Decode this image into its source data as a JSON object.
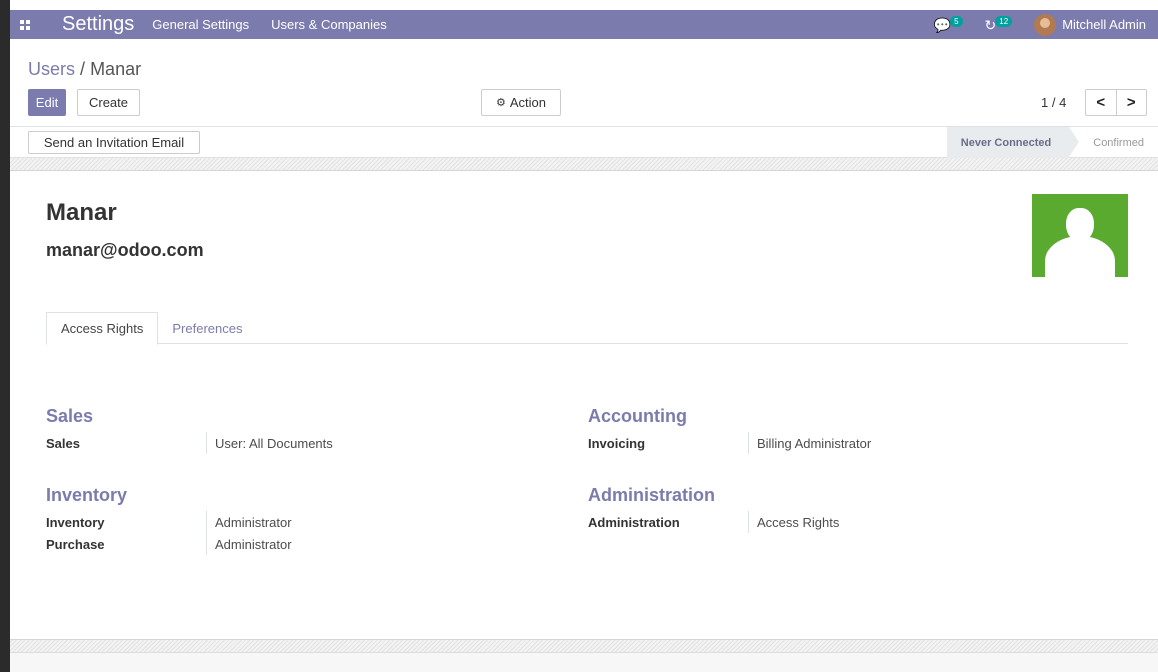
{
  "navbar": {
    "app_title": "Settings",
    "menu": [
      {
        "label": "General Settings"
      },
      {
        "label": "Users & Companies"
      }
    ],
    "messages_count": "5",
    "activities_count": "12",
    "user_name": "Mitchell Admin",
    "accent_color": "#7c7bad"
  },
  "breadcrumb": {
    "parent": "Users",
    "separator": "/",
    "current": "Manar"
  },
  "buttons": {
    "edit": "Edit",
    "create": "Create",
    "action": "Action",
    "invite": "Send an Invitation Email"
  },
  "pager": {
    "value": "1 / 4",
    "prev": "<",
    "next": ">"
  },
  "status": {
    "stages": [
      {
        "label": "Never Connected",
        "active": true
      },
      {
        "label": "Confirmed",
        "active": false
      }
    ]
  },
  "record": {
    "name": "Manar",
    "email": "manar@odoo.com",
    "photo_color": "#5aaa2f"
  },
  "tabs": [
    {
      "label": "Access Rights",
      "active": true
    },
    {
      "label": "Preferences",
      "active": false
    }
  ],
  "groups": {
    "sales": {
      "title": "Sales",
      "fields": [
        {
          "label": "Sales",
          "value": "User: All Documents"
        }
      ]
    },
    "inventory": {
      "title": "Inventory",
      "fields": [
        {
          "label": "Inventory",
          "value": "Administrator"
        },
        {
          "label": "Purchase",
          "value": "Administrator"
        }
      ]
    },
    "accounting": {
      "title": "Accounting",
      "fields": [
        {
          "label": "Invoicing",
          "value": "Billing Administrator"
        }
      ]
    },
    "administration": {
      "title": "Administration",
      "fields": [
        {
          "label": "Administration",
          "value": "Access Rights"
        }
      ]
    }
  }
}
